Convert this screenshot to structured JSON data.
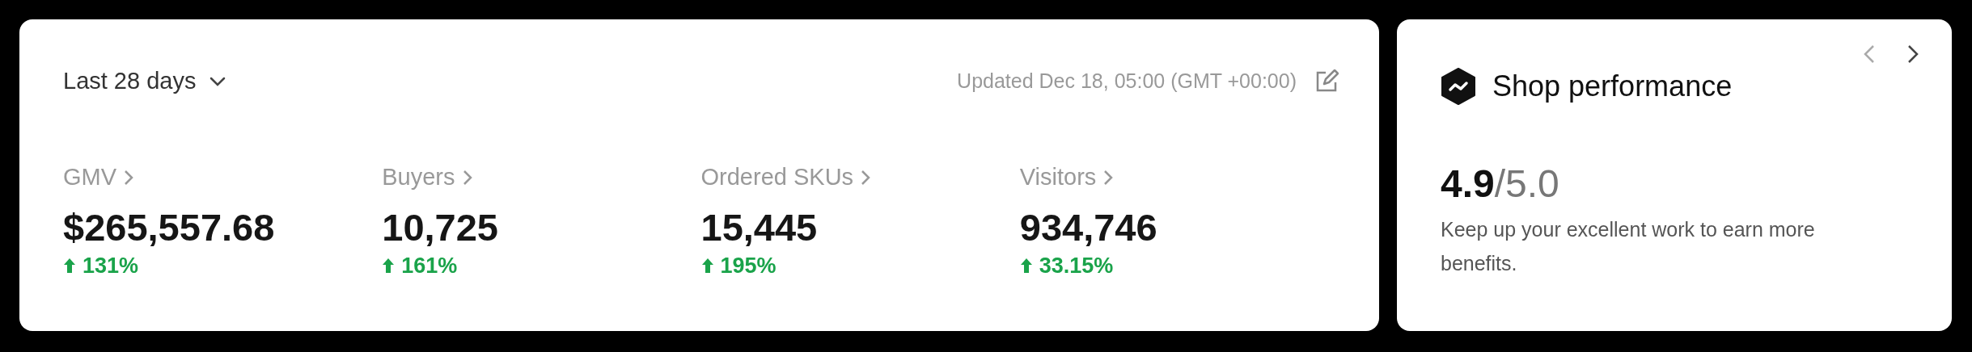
{
  "overview": {
    "period": "Last 28 days",
    "updated": "Updated Dec 18, 05:00 (GMT +00:00)",
    "metrics": [
      {
        "label": "GMV",
        "value": "$265,557.68",
        "change": "131%",
        "increase": true
      },
      {
        "label": "Buyers",
        "value": "10,725",
        "change": "161%",
        "increase": true
      },
      {
        "label": "Ordered SKUs",
        "value": "15,445",
        "change": "195%",
        "increase": true
      },
      {
        "label": "Visitors",
        "value": "934,746",
        "change": "33.15%",
        "increase": true
      }
    ]
  },
  "shop_performance": {
    "title": "Shop performance",
    "score": "4.9",
    "max_score": "/5.0",
    "description": "Keep up your excellent work to earn more benefits.",
    "prev_disabled": true,
    "next_disabled": false
  }
}
